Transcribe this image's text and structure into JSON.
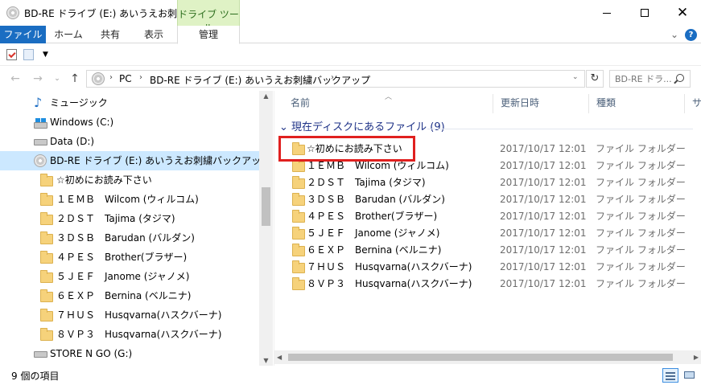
{
  "window": {
    "title": "BD-RE ドライブ (E:) あいうえお刺繍バ...",
    "tool_tab_header": "ドライブ ツール",
    "minimize_label": "",
    "maximize_label": "",
    "close_label": "✕"
  },
  "ribbon": {
    "tabs": [
      "ファイル",
      "ホーム",
      "共有",
      "表示",
      "管理"
    ],
    "help": "?"
  },
  "address": {
    "crumbs": [
      "PC",
      "BD-RE ドライブ (E:) あいうえお刺繍バックアップ"
    ],
    "search_placeholder": "BD-RE ドラ..."
  },
  "nav": {
    "items": [
      {
        "label": "ミュージック",
        "icon": "music-icon"
      },
      {
        "label": "Windows (C:)",
        "icon": "hdd-icon"
      },
      {
        "label": "Data (D:)",
        "icon": "hdd-icon"
      },
      {
        "label": "BD-RE ドライブ (E:) あいうえお刺繍バックアップ",
        "icon": "disc-icon",
        "selected": true
      },
      {
        "label": "☆初めにお読み下さい",
        "icon": "folder-icon"
      },
      {
        "label": "１ＥＭＢ　Wilcom (ウィルコム)",
        "icon": "folder-icon"
      },
      {
        "label": "２ＤＳＴ　Tajima (タジマ)",
        "icon": "folder-icon"
      },
      {
        "label": "３ＤＳＢ　Barudan (バルダン)",
        "icon": "folder-icon"
      },
      {
        "label": "４ＰＥＳ　Brother(ブラザー)",
        "icon": "folder-icon"
      },
      {
        "label": "５ＪＥＦ　Janome (ジャノメ)",
        "icon": "folder-icon"
      },
      {
        "label": "６ＥＸＰ　Bernina (ベルニナ)",
        "icon": "folder-icon"
      },
      {
        "label": "７ＨＵＳ　Husqvarna(ハスクバーナ)",
        "icon": "folder-icon"
      },
      {
        "label": "８ＶＰ３　Husqvarna(ハスクバーナ)",
        "icon": "folder-icon"
      },
      {
        "label": "STORE N GO (G:)",
        "icon": "hdd-icon"
      }
    ]
  },
  "content": {
    "columns": {
      "name": "名前",
      "date": "更新日時",
      "type": "種類",
      "size": "サ"
    },
    "group_header": "現在ディスクにあるファイル (9)",
    "files": [
      {
        "name": "☆初めにお読み下さい",
        "date": "2017/10/17 12:01",
        "type": "ファイル フォルダー",
        "highlighted": true
      },
      {
        "name": "１ＥＭＢ　Wilcom (ウィルコム)",
        "date": "2017/10/17 12:01",
        "type": "ファイル フォルダー"
      },
      {
        "name": "２ＤＳＴ　Tajima (タジマ)",
        "date": "2017/10/17 12:01",
        "type": "ファイル フォルダー"
      },
      {
        "name": "３ＤＳＢ　Barudan (バルダン)",
        "date": "2017/10/17 12:01",
        "type": "ファイル フォルダー"
      },
      {
        "name": "４ＰＥＳ　Brother(ブラザー)",
        "date": "2017/10/17 12:01",
        "type": "ファイル フォルダー"
      },
      {
        "name": "５ＪＥＦ　Janome (ジャノメ)",
        "date": "2017/10/17 12:01",
        "type": "ファイル フォルダー"
      },
      {
        "name": "６ＥＸＰ　Bernina (ベルニナ)",
        "date": "2017/10/17 12:01",
        "type": "ファイル フォルダー"
      },
      {
        "name": "７ＨＵＳ　Husqvarna(ハスクバーナ)",
        "date": "2017/10/17 12:01",
        "type": "ファイル フォルダー"
      },
      {
        "name": "８ＶＰ３　Husqvarna(ハスクバーナ)",
        "date": "2017/10/17 12:01",
        "type": "ファイル フォルダー"
      }
    ]
  },
  "status": {
    "item_count": "9 個の項目"
  },
  "colors": {
    "file_tab": "#1a6dc2",
    "tool_tab": "#dff2c5",
    "selection": "#cce8ff",
    "highlight_box": "#e0201f",
    "group_header": "#1e3287"
  }
}
